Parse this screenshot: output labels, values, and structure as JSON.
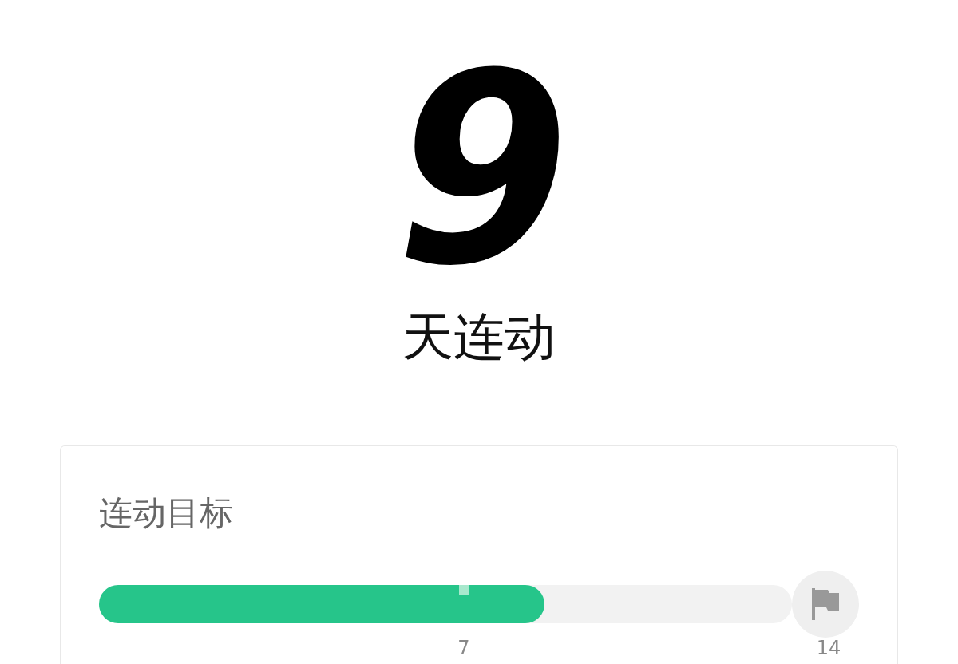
{
  "streak": {
    "count": "9",
    "label": "天连动"
  },
  "goal": {
    "title": "连动目标",
    "level": 0.643,
    "ticks": [
      {
        "label": "7"
      },
      {
        "label": "14"
      }
    ]
  }
}
